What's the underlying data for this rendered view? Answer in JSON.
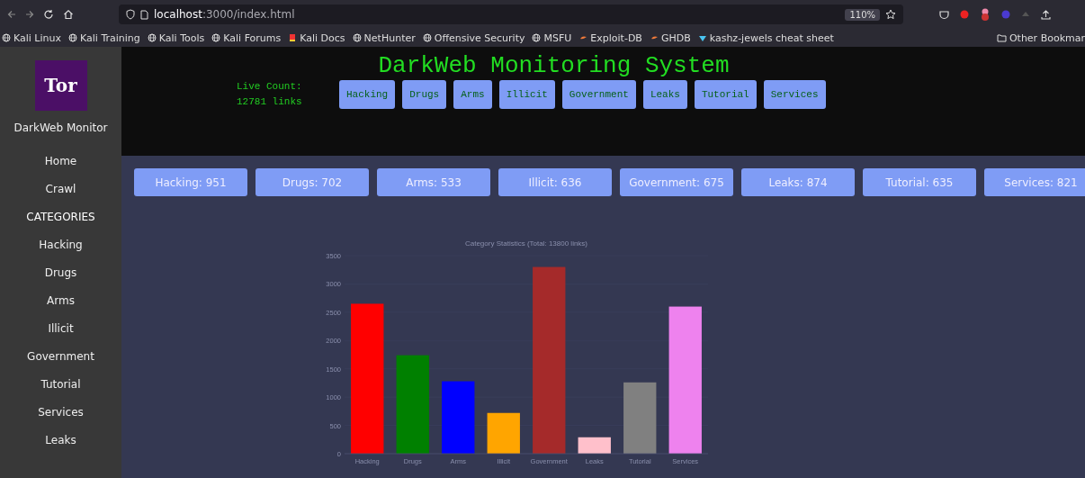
{
  "browser": {
    "url_host": "localhost",
    "url_rest": ":3000/index.html",
    "zoom": "110%",
    "bookmarks": [
      {
        "label": "Kali Linux",
        "kind": "globe"
      },
      {
        "label": "Kali Training",
        "kind": "globe"
      },
      {
        "label": "Kali Tools",
        "kind": "globe"
      },
      {
        "label": "Kali Forums",
        "kind": "globe"
      },
      {
        "label": "Kali Docs",
        "kind": "docs"
      },
      {
        "label": "NetHunter",
        "kind": "globe"
      },
      {
        "label": "Offensive Security",
        "kind": "globe"
      },
      {
        "label": "MSFU",
        "kind": "globe"
      },
      {
        "label": "Exploit-DB",
        "kind": "flame"
      },
      {
        "label": "GHDB",
        "kind": "flame"
      },
      {
        "label": "kashz-jewels cheat sheet",
        "kind": "gem"
      }
    ],
    "other_bookmarks": "Other Bookmar"
  },
  "sidebar": {
    "logo_text": "Tor",
    "brand": "DarkWeb Monitor",
    "items": [
      {
        "label": "Home",
        "kind": "link"
      },
      {
        "label": "Crawl",
        "kind": "link"
      },
      {
        "label": "CATEGORIES",
        "kind": "heading"
      },
      {
        "label": "Hacking",
        "kind": "link"
      },
      {
        "label": "Drugs",
        "kind": "link"
      },
      {
        "label": "Arms",
        "kind": "link"
      },
      {
        "label": "Illicit",
        "kind": "link"
      },
      {
        "label": "Government",
        "kind": "link"
      },
      {
        "label": "Tutorial",
        "kind": "link"
      },
      {
        "label": "Services",
        "kind": "link"
      },
      {
        "label": "Leaks",
        "kind": "link"
      }
    ]
  },
  "header": {
    "title": "DarkWeb Monitoring System",
    "live_count_label": "Live Count:",
    "live_count": "12781 links",
    "category_buttons": [
      "Hacking",
      "Drugs",
      "Arms",
      "Illicit",
      "Government",
      "Leaks",
      "Tutorial",
      "Services"
    ]
  },
  "stats": [
    "Hacking: 951",
    "Drugs: 702",
    "Arms: 533",
    "Illicit: 636",
    "Government: 675",
    "Leaks: 874",
    "Tutorial: 635",
    "Services: 821"
  ],
  "chart_data": {
    "type": "bar",
    "title": "Category Statistics (Total: 13800 links)",
    "categories": [
      "Hacking",
      "Drugs",
      "Arms",
      "Illicit",
      "Government",
      "Leaks",
      "Tutorial",
      "Services"
    ],
    "grid": true,
    "series": [
      {
        "colors": [
          "#ff0000",
          "#008000",
          "#0000ff",
          "#ffa500",
          "#a52a2a",
          "#ffc0cb",
          "#808080",
          "#ee82ee"
        ],
        "values": [
          2650,
          1740,
          1280,
          720,
          3300,
          290,
          1260,
          2600
        ]
      }
    ],
    "ylim": [
      0,
      3500
    ],
    "yticks": [
      0,
      500,
      1000,
      1500,
      2000,
      2500,
      3000,
      3500
    ]
  }
}
